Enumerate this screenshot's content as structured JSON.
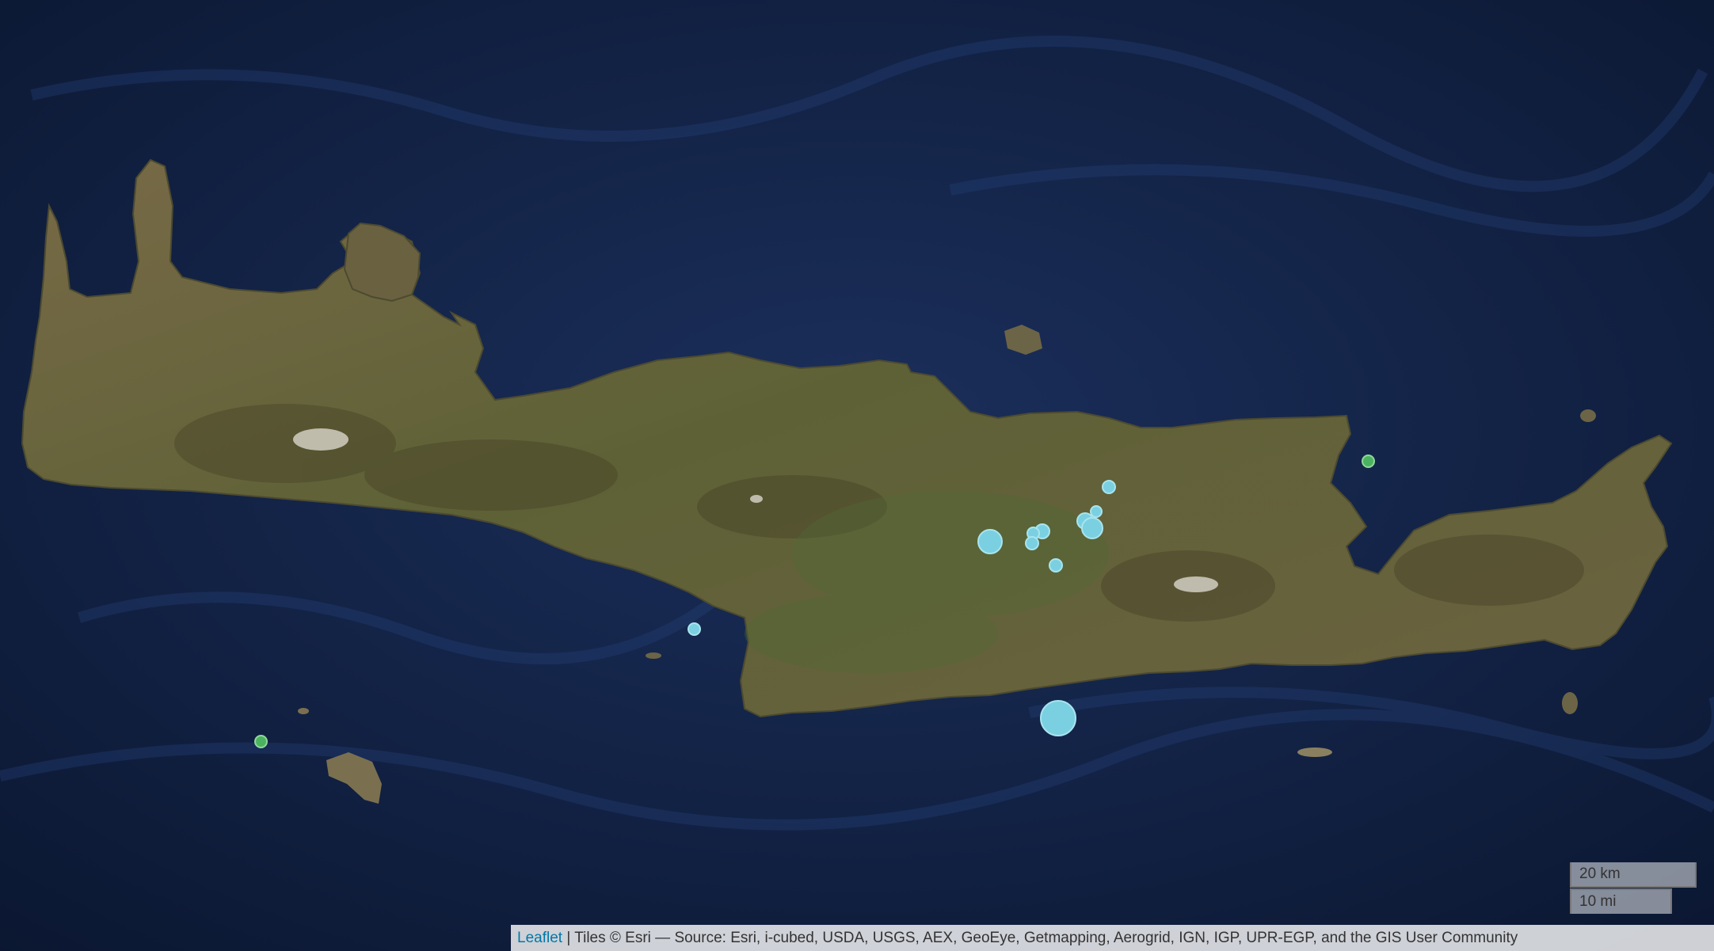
{
  "map": {
    "basemap": "satellite imagery",
    "sea_color": "#13254a",
    "land_color": "#5f5b36",
    "marker_colors": {
      "blue": "#7ad0e0",
      "green": "#4bb35f"
    }
  },
  "scale": {
    "km_label": "20 km",
    "mi_label": "10 mi"
  },
  "attribution": {
    "leaflet_link": "Leaflet",
    "text": " | Tiles © Esri — Source: Esri, i-cubed, USDA, USGS, AEX, GeoEye, Getmapping, Aerogrid, IGN, IGP, UPR-EGP, and the GIS User Community"
  }
}
